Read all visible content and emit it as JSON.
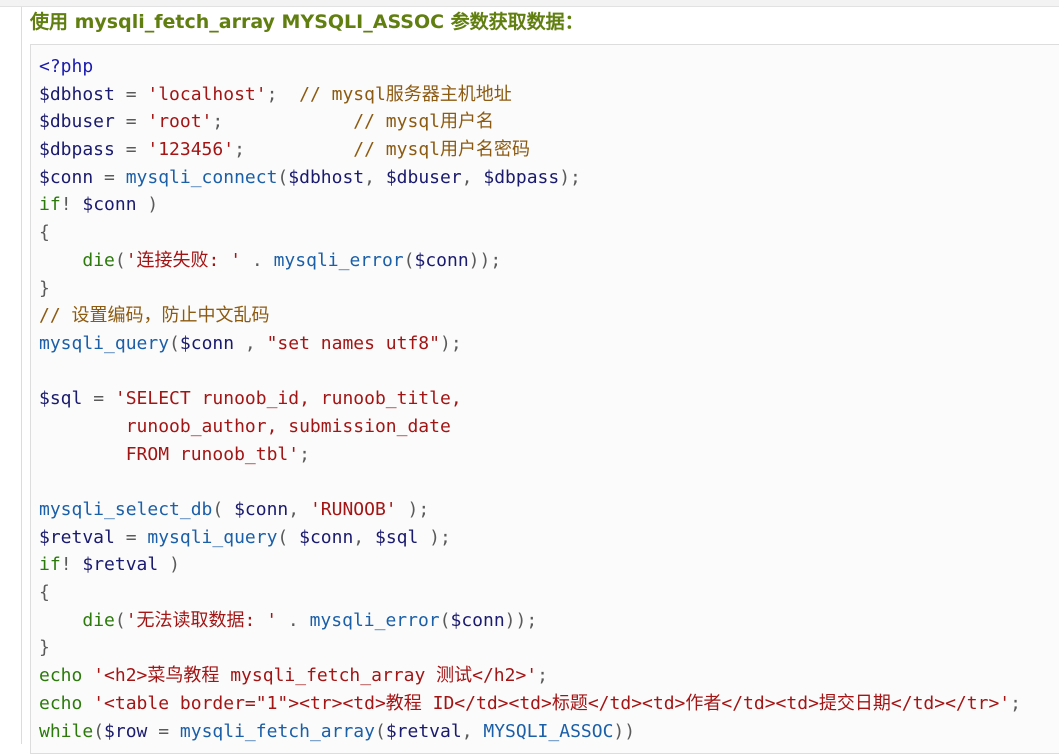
{
  "heading": "使用 mysqli_fetch_array MYSQLI_ASSOC 参数获取数据：",
  "colors": {
    "heading": "#617f10",
    "variable": "#1a1a6e",
    "string": "#a31515",
    "comment": "#8c5a10",
    "function": "#1b5fa8",
    "control": "#2b7a0b",
    "php_tag": "#1a1ab0"
  },
  "code_lines": [
    [
      [
        "tag",
        "<?php"
      ]
    ],
    [
      [
        "var",
        "$dbhost"
      ],
      [
        "pun",
        " = "
      ],
      [
        "str",
        "'localhost'"
      ],
      [
        "pun",
        ";  "
      ],
      [
        "com",
        "// mysql服务器主机地址"
      ]
    ],
    [
      [
        "var",
        "$dbuser"
      ],
      [
        "pun",
        " = "
      ],
      [
        "str",
        "'root'"
      ],
      [
        "pun",
        ";            "
      ],
      [
        "com",
        "// mysql用户名"
      ]
    ],
    [
      [
        "var",
        "$dbpass"
      ],
      [
        "pun",
        " = "
      ],
      [
        "str",
        "'123456'"
      ],
      [
        "pun",
        ";          "
      ],
      [
        "com",
        "// mysql用户名密码"
      ]
    ],
    [
      [
        "var",
        "$conn"
      ],
      [
        "pun",
        " = "
      ],
      [
        "fn",
        "mysqli_connect"
      ],
      [
        "pun",
        "("
      ],
      [
        "var",
        "$dbhost"
      ],
      [
        "pun",
        ", "
      ],
      [
        "var",
        "$dbuser"
      ],
      [
        "pun",
        ", "
      ],
      [
        "var",
        "$dbpass"
      ],
      [
        "pun",
        ");"
      ]
    ],
    [
      [
        "ctl",
        "if"
      ],
      [
        "pun",
        "! "
      ],
      [
        "var",
        "$conn"
      ],
      [
        "pun",
        " )"
      ]
    ],
    [
      [
        "pun",
        "{"
      ]
    ],
    [
      [
        "pun",
        "    "
      ],
      [
        "ctl",
        "die"
      ],
      [
        "pun",
        "("
      ],
      [
        "str",
        "'连接失败: '"
      ],
      [
        "pun",
        " . "
      ],
      [
        "fn",
        "mysqli_error"
      ],
      [
        "pun",
        "("
      ],
      [
        "var",
        "$conn"
      ],
      [
        "pun",
        "));"
      ]
    ],
    [
      [
        "pun",
        "}"
      ]
    ],
    [
      [
        "com",
        "// 设置编码，防止中文乱码"
      ]
    ],
    [
      [
        "fn",
        "mysqli_query"
      ],
      [
        "pun",
        "("
      ],
      [
        "var",
        "$conn"
      ],
      [
        "pun",
        " , "
      ],
      [
        "str",
        "\"set names utf8\""
      ],
      [
        "pun",
        ");"
      ]
    ],
    [
      [
        "pun",
        ""
      ]
    ],
    [
      [
        "var",
        "$sql"
      ],
      [
        "pun",
        " = "
      ],
      [
        "str",
        "'SELECT runoob_id, runoob_title,"
      ]
    ],
    [
      [
        "str",
        "        runoob_author, submission_date"
      ]
    ],
    [
      [
        "str",
        "        FROM runoob_tbl'"
      ],
      [
        "pun",
        ";"
      ]
    ],
    [
      [
        "pun",
        ""
      ]
    ],
    [
      [
        "fn",
        "mysqli_select_db"
      ],
      [
        "pun",
        "( "
      ],
      [
        "var",
        "$conn"
      ],
      [
        "pun",
        ", "
      ],
      [
        "str",
        "'RUNOOB'"
      ],
      [
        "pun",
        " );"
      ]
    ],
    [
      [
        "var",
        "$retval"
      ],
      [
        "pun",
        " = "
      ],
      [
        "fn",
        "mysqli_query"
      ],
      [
        "pun",
        "( "
      ],
      [
        "var",
        "$conn"
      ],
      [
        "pun",
        ", "
      ],
      [
        "var",
        "$sql"
      ],
      [
        "pun",
        " );"
      ]
    ],
    [
      [
        "ctl",
        "if"
      ],
      [
        "pun",
        "! "
      ],
      [
        "var",
        "$retval"
      ],
      [
        "pun",
        " )"
      ]
    ],
    [
      [
        "pun",
        "{"
      ]
    ],
    [
      [
        "pun",
        "    "
      ],
      [
        "ctl",
        "die"
      ],
      [
        "pun",
        "("
      ],
      [
        "str",
        "'无法读取数据: '"
      ],
      [
        "pun",
        " . "
      ],
      [
        "fn",
        "mysqli_error"
      ],
      [
        "pun",
        "("
      ],
      [
        "var",
        "$conn"
      ],
      [
        "pun",
        "));"
      ]
    ],
    [
      [
        "pun",
        "}"
      ]
    ],
    [
      [
        "ctl",
        "echo"
      ],
      [
        "pun",
        " "
      ],
      [
        "str",
        "'<h2>菜鸟教程 mysqli_fetch_array 测试</h2>'"
      ],
      [
        "pun",
        ";"
      ]
    ],
    [
      [
        "ctl",
        "echo"
      ],
      [
        "pun",
        " "
      ],
      [
        "str",
        "'<table border=\"1\"><tr><td>教程 ID</td><td>标题</td><td>作者</td><td>提交日期</td></tr>'"
      ],
      [
        "pun",
        ";"
      ]
    ],
    [
      [
        "ctl",
        "while"
      ],
      [
        "pun",
        "("
      ],
      [
        "var",
        "$row"
      ],
      [
        "pun",
        " = "
      ],
      [
        "fn",
        "mysqli_fetch_array"
      ],
      [
        "pun",
        "("
      ],
      [
        "var",
        "$retval"
      ],
      [
        "pun",
        ", "
      ],
      [
        "fn",
        "MYSQLI_ASSOC"
      ],
      [
        "pun",
        "))"
      ]
    ]
  ]
}
